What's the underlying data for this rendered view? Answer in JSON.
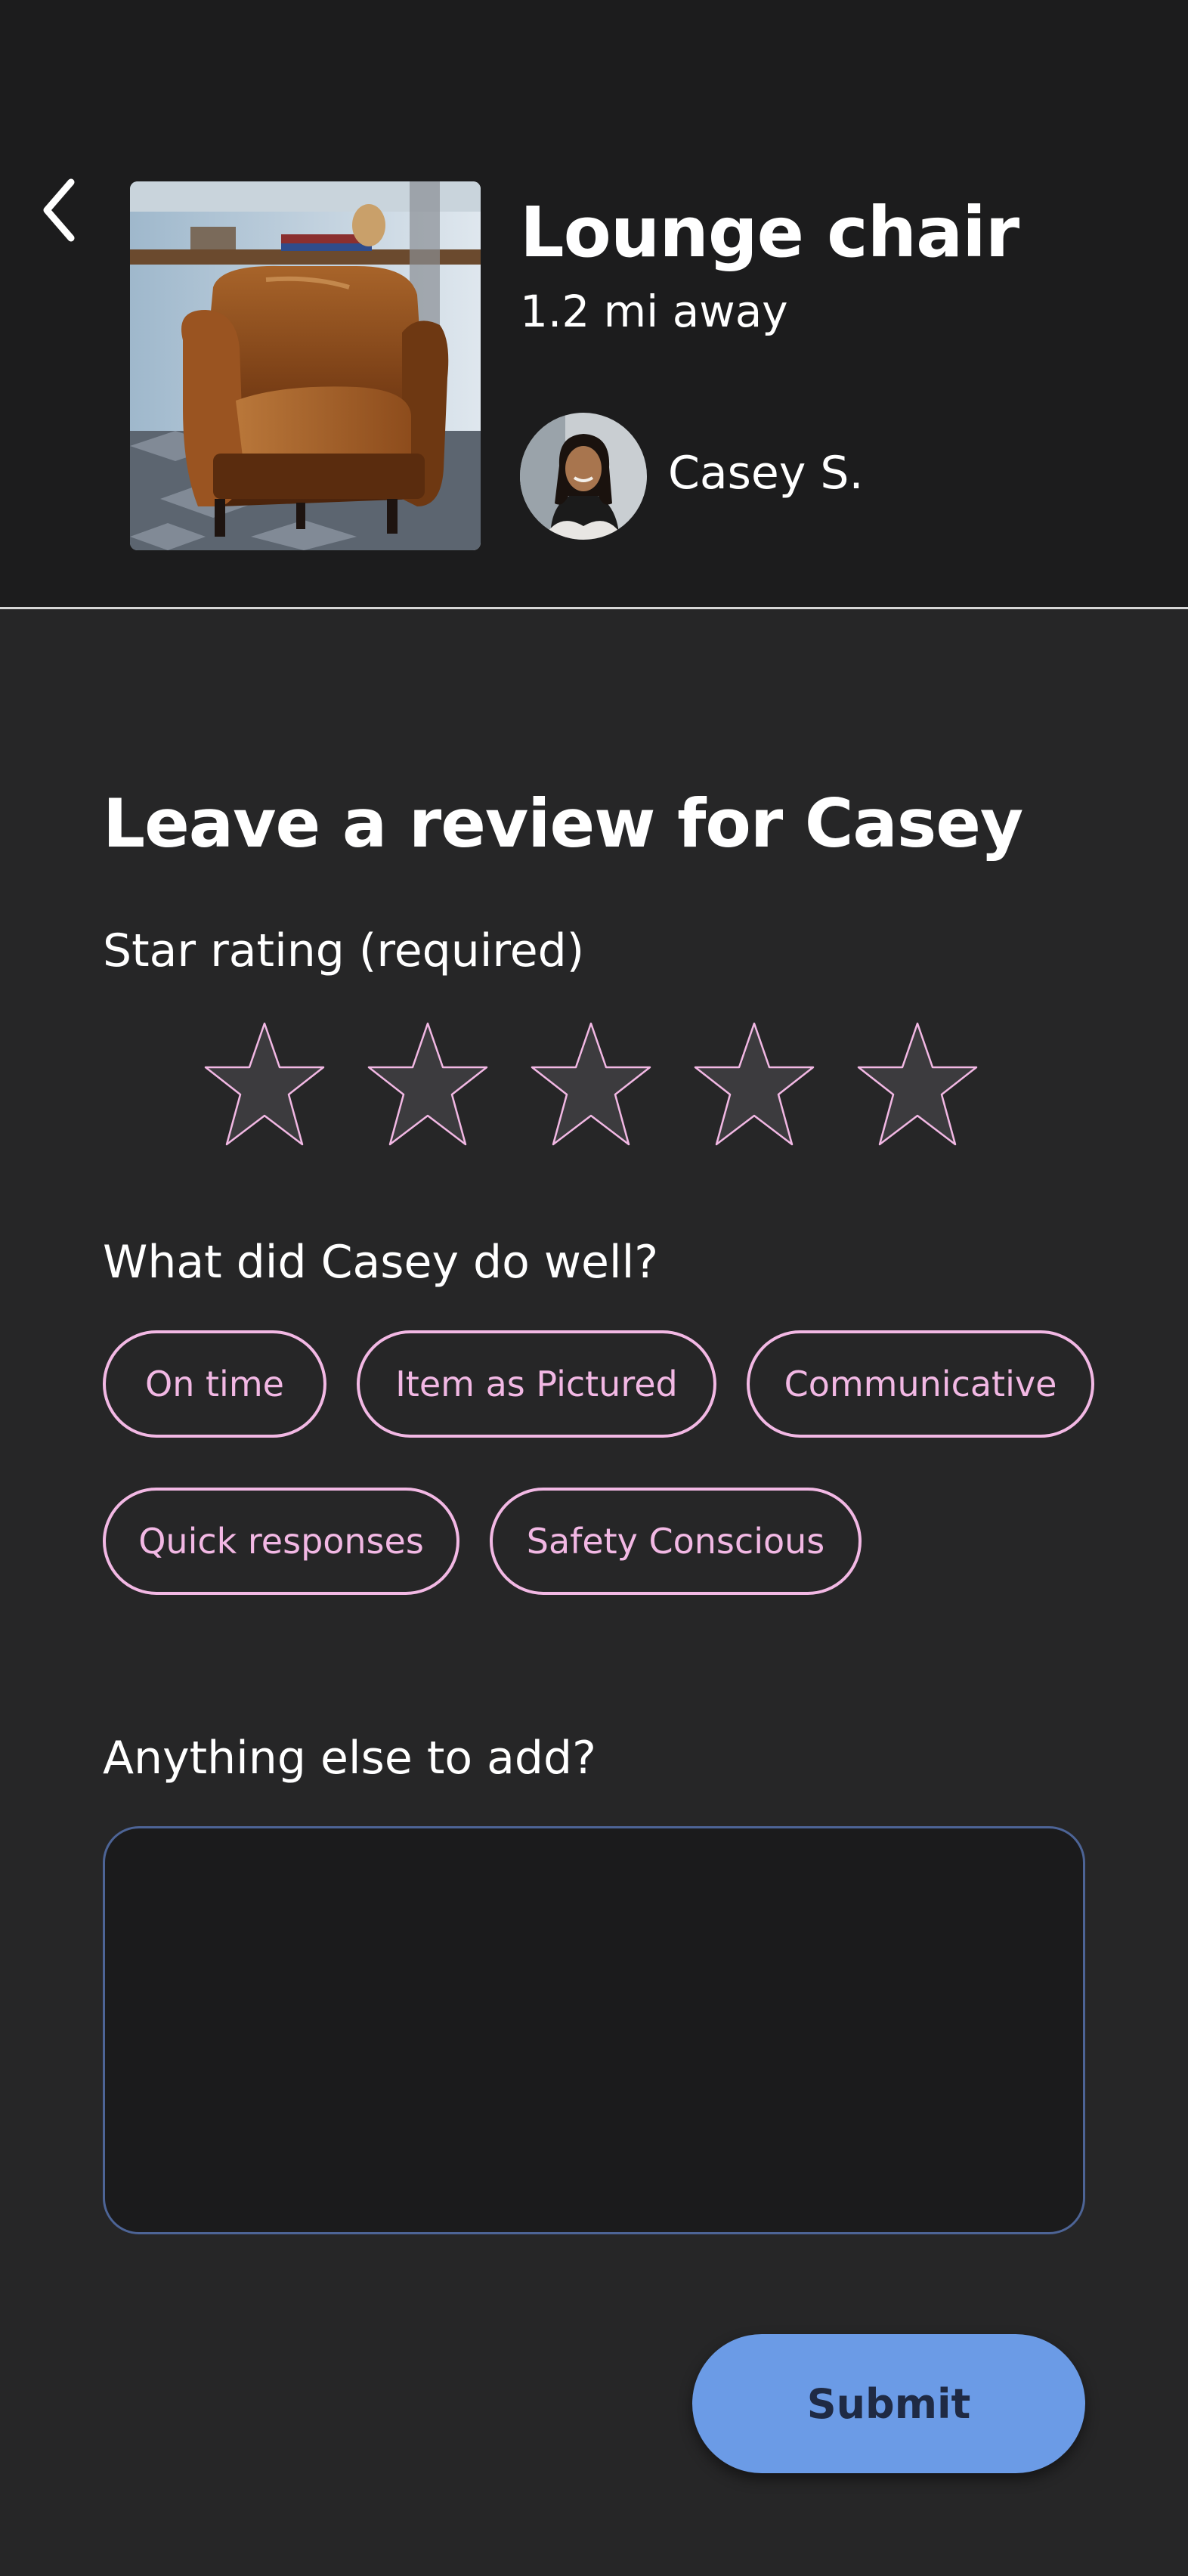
{
  "header": {
    "back_icon": "chevron-left-icon",
    "item_title": "Lounge chair",
    "item_distance": "1.2 mi away",
    "seller_name": "Casey S."
  },
  "review": {
    "heading": "Leave a review for Casey",
    "rating_label": "Star rating (required)",
    "rating_value": 0,
    "rating_max": 5,
    "well_label": "What did Casey do well?",
    "chips": [
      "On time",
      "Item as Pictured",
      "Communicative",
      "Quick responses",
      "Safety Conscious"
    ],
    "add_label": "Anything else to add?",
    "comment_value": "",
    "submit_label": "Submit"
  },
  "colors": {
    "header_bg": "#1c1c1d",
    "page_bg": "#262627",
    "accent_pink": "#f2b8e4",
    "star_fill": "#3c3b3e",
    "submit_bg": "#6b9be6",
    "input_border": "#4d6496"
  }
}
